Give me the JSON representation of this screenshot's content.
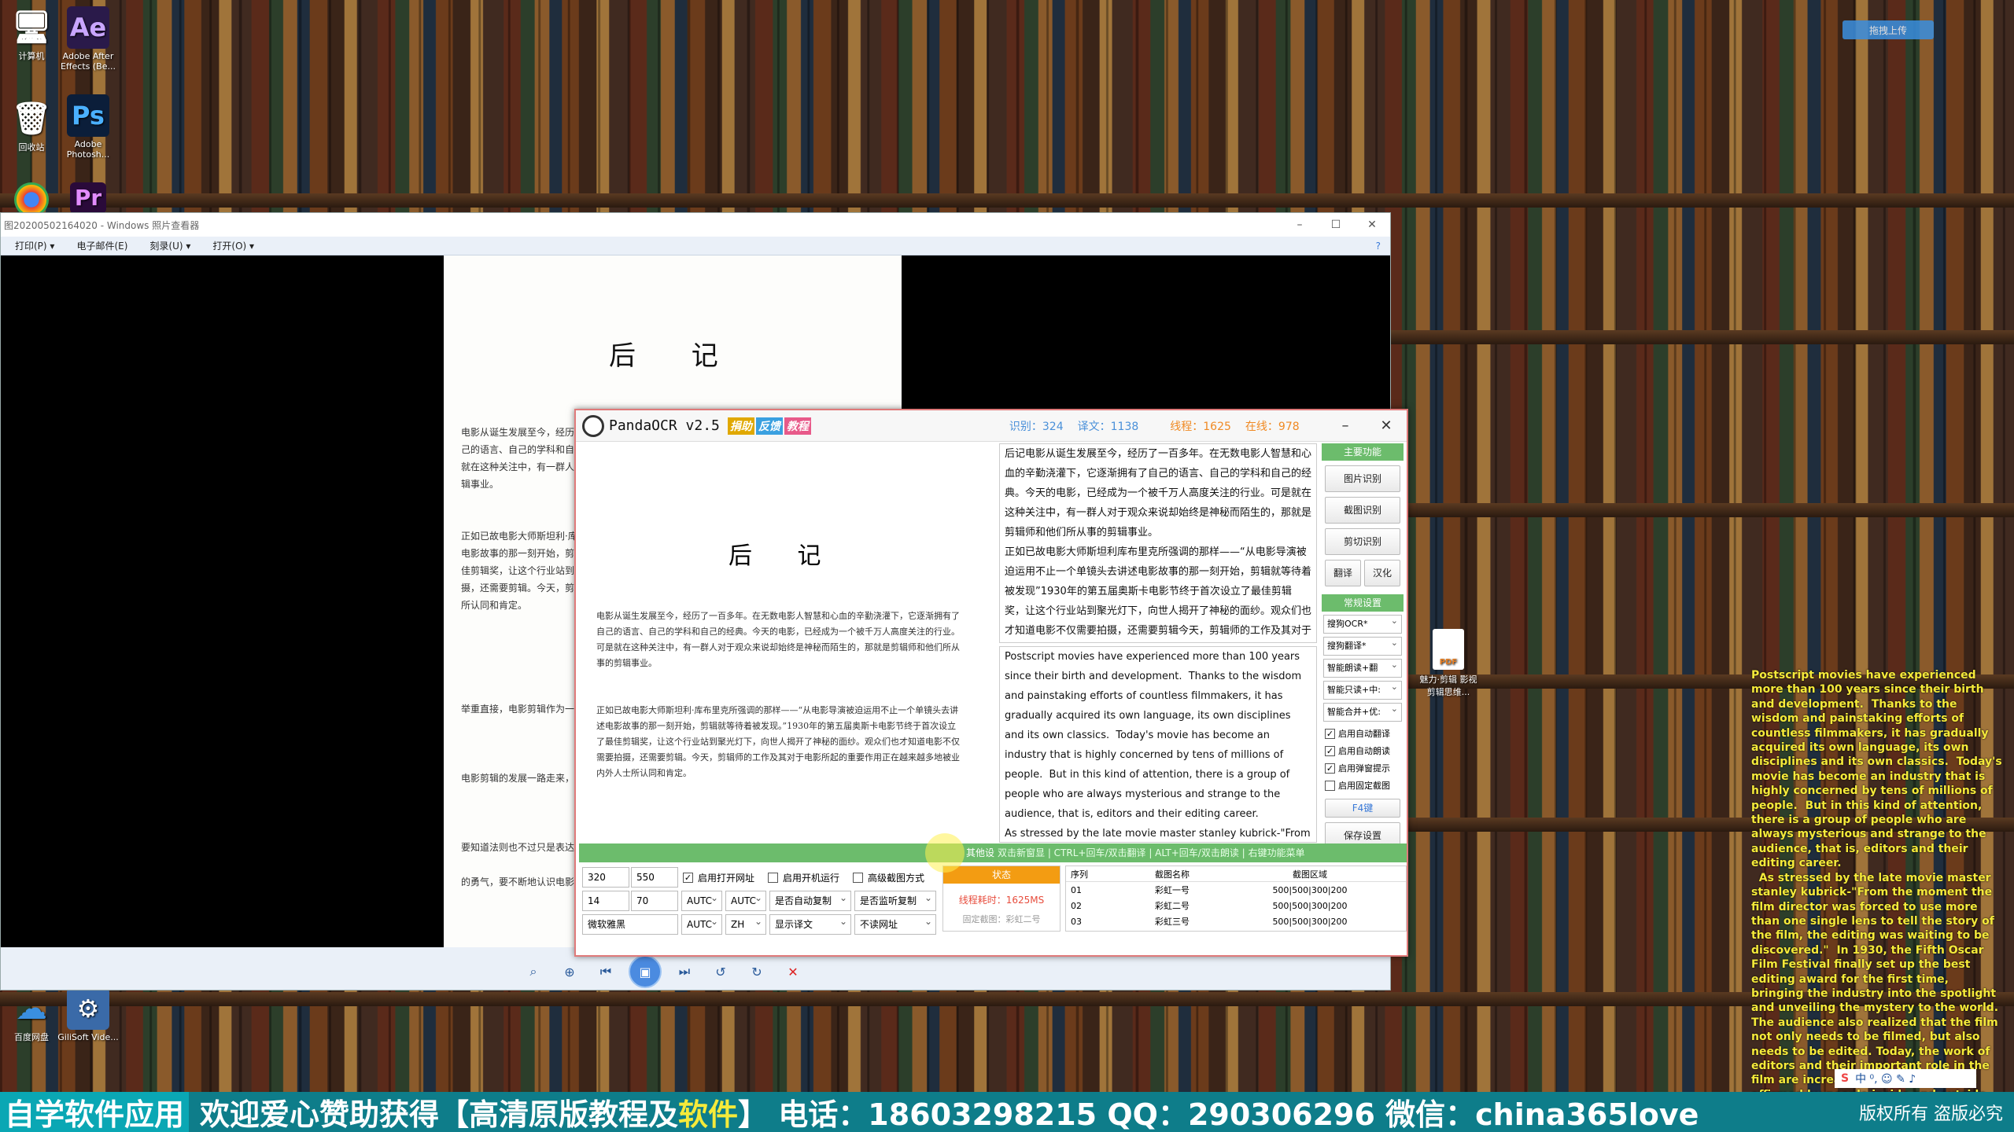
{
  "desktop": {
    "icons": [
      {
        "label": "计算机",
        "color": "#4aa3ff",
        "glyph": "🖥"
      },
      {
        "label": "Adobe After Effects (Be...",
        "color": "#2a1a4a",
        "glyph": "Ae"
      },
      {
        "label": "回收站",
        "color": "#8fb8d8",
        "glyph": "🗑"
      },
      {
        "label": "Adobe Photosh...",
        "color": "#0b1e3a",
        "glyph": "Ps"
      },
      {
        "label": "百度网盘",
        "color": "#2e6fd8",
        "glyph": "☁"
      },
      {
        "label": "GiliSoft Vide...",
        "color": "#3a6aa8",
        "glyph": "⚙"
      }
    ],
    "upload_button": "拖拽上传",
    "pdf_icon_label": "魅力·剪辑 影视剪辑思维..."
  },
  "viewer": {
    "title": "图20200502164020 - Windows 照片查看器",
    "menu": [
      "打印(P) ▾",
      "电子邮件(E)",
      "刻录(U) ▾",
      "打开(O) ▾"
    ],
    "page_heading": "后 记",
    "page_paragraphs": [
      "电影从诞生发展至今，经历了一百多年。在无数电影人智慧和心血的辛勤浇灌下，它逐渐拥有了自己的语言、自己的学科和自己的经典。今天的电影，已经成为一个被千万人高度关注的行业。可是就在这种关注中，有一群人对于观众来说却始终是神秘而陌生的，那就是剪辑师和他们所从事的剪辑事业。",
      "正如已故电影大师斯坦利·库布里克所强调的那样——“从电影导演被迫运用不止一个单镜头去讲述电影故事的那一刻开始，剪辑就等待着被发现。”1930年的第五届奥斯卡电影节终于首次设立了最佳剪辑奖，让这个行业站到聚光灯下，向世人揭开了神秘的面纱。观众们也才知道电影不仅需要拍摄，还需要剪辑。今天，剪辑师的工作及其对于电影所起的重要作用正在越来越多地被业内外人士所认同和肯定。",
      "举重直接，电影剪辑作为一种艺术创造性的劳动，其作用和意义愈发凸显。",
      "电影剪辑的发展一路走来，文本创新中传承。",
      "要知道法则也不过只是表达的一种工具，",
      "的勇气，要不断地认识电影艺术的本质。"
    ]
  },
  "ocr": {
    "title": "PandaOCR v2.5",
    "tags": [
      {
        "label": "捐助",
        "color": "#e0a800"
      },
      {
        "label": "反馈",
        "color": "#3aa0e0"
      },
      {
        "label": "教程",
        "color": "#e85a8a"
      }
    ],
    "stats": {
      "recognize": "识别：324",
      "translate": "译文：1138",
      "threads": "线程：1625",
      "online": "在线：978"
    },
    "source_heading": "后 记",
    "source_paragraphs": [
      "电影从诞生发展至今，经历了一百多年。在无数电影人智慧和心血的辛勤浇灌下，它逐渐拥有了自己的语言、自己的学科和自己的经典。今天的电影，已经成为一个被千万人高度关注的行业。可是就在这种关注中，有一群人对于观众来说却始终是神秘而陌生的，那就是剪辑师和他们所从事的剪辑事业。",
      "正如已故电影大师斯坦利·库布里克所强调的那样——“从电影导演被迫运用不止一个单镜头去讲述电影故事的那一刻开始，剪辑就等待着被发现。”1930年的第五届奥斯卡电影节终于首次设立了最佳剪辑奖，让这个行业站到聚光灯下，向世人揭开了神秘的面纱。观众们也才知道电影不仅需要拍摄，还需要剪辑。今天，剪辑师的工作及其对于电影所起的重要作用正在越来越多地被业内外人士所认同和肯定。"
    ],
    "recognized_text": "后记电影从诞生发展至今，经历了一百多年。在无数电影人智慧和心血的辛勤浇灌下，它逐渐拥有了自己的语言、自己的学科和自己的经典。今天的电影，已经成为一个被千万人高度关注的行业。可是就在这种关注中，有一群人对于观众来说却始终是神秘而陌生的，那就是剪辑师和他们所从事的剪辑事业。\n正如已故电影大师斯坦利库布里克所强调的那样——“从电影导演被迫运用不止一个单镜头去讲述电影故事的那一刻开始，剪辑就等待着被发现”1930年的第五届奥斯卡电影节终于首次设立了最佳剪辑奖，让这个行业站到聚光灯下，向世人揭开了神秘的面纱。观众们也才知道电影不仅需要拍摄，还需要剪辑今天，剪辑师的工作及其对于电影所起的重要作用正在越来越多地被业内外人士所认同和肯定。",
    "translated_text": "Postscript movies have experienced more than 100 years since their birth and development.  Thanks to the wisdom and painstaking efforts of countless filmmakers, it has gradually acquired its own language, its own disciplines and its own classics.  Today's movie has become an industry that is highly concerned by tens of millions of people.  But in this kind of attention, there is a group of people who are always mysterious and strange to the audience, that is, editors and their editing career.\nAs stressed by the late movie master stanley kubrick-\"From the moment the film director was forced to use more than one single lens to tell the story of the film, the editing was waiting to be discovered.\"",
    "side": {
      "head_main": "主要功能",
      "btn_image": "图片识别",
      "btn_screenshot": "截图识别",
      "btn_clip": "剪切识别",
      "btn_translate": "翻译",
      "btn_chinese": "汉化",
      "head_settings": "常规设置",
      "sel_ocr": "搜狗OCR*",
      "sel_trans": "搜狗翻译*",
      "sel_read": "智能朗读+翻",
      "sel_only": "智能只读+中:",
      "sel_merge": "智能合并+优:",
      "chk_auto_translate": "启用自动翻译",
      "chk_auto_read": "启用自动朗读",
      "chk_popup": "启用弹窗提示",
      "chk_fixed": "启用固定截图",
      "hotkey": "F4键",
      "save": "保存设置"
    },
    "greenbar_other": "其他设",
    "greenbar_tip": "双击新窗显 | CTRL+回车/双击翻译 | ALT+回车/双击朗读 | 右键功能菜单",
    "bottom": {
      "w": "320",
      "h": "550",
      "x": "14",
      "y": "70",
      "font": "微软雅黑",
      "auto1": "AUTC",
      "auto2": "AUTC",
      "auto3": "AUTC",
      "zh": "ZH",
      "chk_open_url": "启用打开网址",
      "chk_startup": "启用开机运行",
      "chk_advanced": "高级截图方式",
      "sel_copy": "是否自动复制",
      "sel_listen": "是否监听复制",
      "sel_display": "显示译文",
      "sel_url": "不读网址"
    },
    "state": {
      "head": "状态",
      "thread_time": "线程耗时：1625MS",
      "fixed": "固定截图：彩虹二号"
    },
    "table": {
      "headers": [
        "序列",
        "截图名称",
        "截图区域"
      ],
      "rows": [
        [
          "01",
          "彩虹一号",
          "500|500|300|200"
        ],
        [
          "02",
          "彩虹二号",
          "500|500|300|200"
        ],
        [
          "03",
          "彩虹三号",
          "500|500|300|200"
        ]
      ]
    }
  },
  "overlay_text": "Postscript movies have experienced more than 100 years since their birth and development.  Thanks to the wisdom and painstaking efforts of countless filmmakers, it has gradually acquired its own language, its own disciplines and its own classics.  Today's movie has become an industry that is highly concerned by tens of millions of people.  But in this kind of attention, there is a group of people who are always mysterious and strange to the audience, that is, editors and their editing career.\n  As stressed by the late movie master stanley kubrick-\"From the moment the film director was forced to use more than one single lens to tell the story of the film, the editing was waiting to be discovered.\"  In 1930, the Fifth Oscar Film Festival finally set up the best editing award for the first time, bringing the industry into the spotlight and unveiling the mystery to the world.  The audience also realized that the film not only needs to be filmed, but also needs to be edited. Today, the work of editors and their important role in the film are increasingly recognized and affirmed by people inside and outside the industry.",
  "banner": {
    "lead": "自学软件应用",
    "text_a": "欢迎爱心赞助获得【高清原版教程及",
    "text_hl": "软件",
    "text_b": "】 电话：18603298215 QQ：290306296 微信：china365love",
    "copyright": "版权所有 盗版必究"
  },
  "tray_text": "中 ⁰, ☺ ✎ ♪"
}
